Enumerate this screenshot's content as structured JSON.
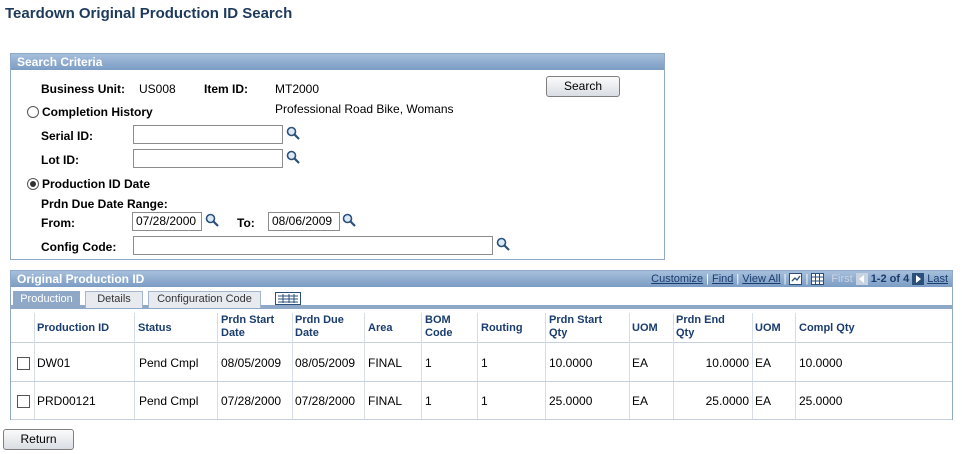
{
  "page": {
    "title": "Teardown Original Production ID Search"
  },
  "search": {
    "header": "Search Criteria",
    "business_unit_label": "Business Unit:",
    "business_unit_value": "US008",
    "item_id_label": "Item ID:",
    "item_id_value": "MT2000",
    "item_description": "Professional Road Bike, Womans",
    "search_button": "Search",
    "completion_history_label": "Completion History",
    "serial_id_label": "Serial ID:",
    "serial_id_value": "",
    "lot_id_label": "Lot ID:",
    "lot_id_value": "",
    "production_id_date_label": "Production ID Date",
    "due_range_label": "Prdn Due Date Range:",
    "from_label": "From:",
    "from_value": "07/28/2000",
    "to_label": "To:",
    "to_value": "08/06/2009",
    "config_code_label": "Config Code:",
    "config_code_value": ""
  },
  "grid": {
    "header": "Original Production ID",
    "nav": {
      "customize": "Customize",
      "find": "Find",
      "view_all": "View All",
      "sep": "|",
      "first": "First",
      "range": "1-2 of 4",
      "last": "Last"
    },
    "tabs": [
      "Production",
      "Details",
      "Configuration Code"
    ],
    "columns": {
      "production_id": "Production ID",
      "status": "Status",
      "prdn_start_date": "Prdn Start Date",
      "prdn_due_date": "Prdn Due Date",
      "area": "Area",
      "bom_code": "BOM Code",
      "routing": "Routing",
      "prdn_start_qty": "Prdn Start Qty",
      "uom1": "UOM",
      "prdn_end_qty": "Prdn End Qty",
      "uom2": "UOM",
      "compl_qty": "Compl Qty"
    },
    "rows": [
      {
        "production_id": "DW01",
        "status": "Pend Cmpl",
        "start": "08/05/2009",
        "due": "08/05/2009",
        "area": "FINAL",
        "bom": "1",
        "routing": "1",
        "start_qty": "10.0000",
        "uom1": "EA",
        "end_qty": "10.0000",
        "uom2": "EA",
        "compl_qty": "10.0000"
      },
      {
        "production_id": "PRD00121",
        "status": "Pend Cmpl",
        "start": "07/28/2000",
        "due": "07/28/2000",
        "area": "FINAL",
        "bom": "1",
        "routing": "1",
        "start_qty": "25.0000",
        "uom1": "EA",
        "end_qty": "25.0000",
        "uom2": "EA",
        "compl_qty": "25.0000"
      }
    ]
  },
  "footer": {
    "return_button": "Return"
  },
  "colors": {
    "header_blue": "#8fa8c7",
    "title": "#1d3a5c",
    "link": "#1a3c6e"
  }
}
